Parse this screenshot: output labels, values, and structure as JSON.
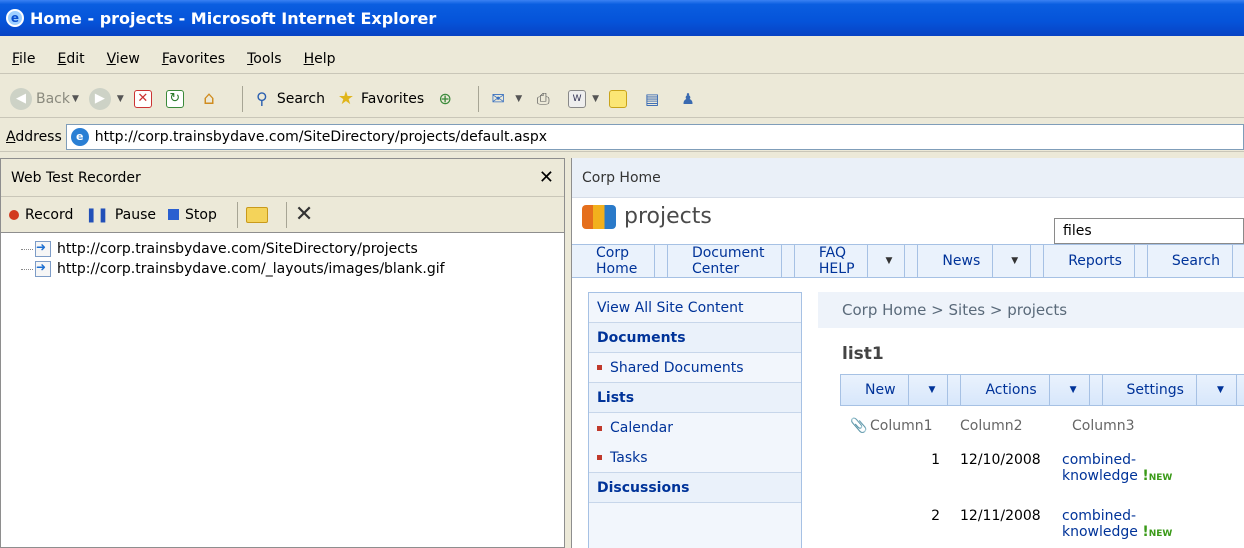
{
  "window": {
    "title": "Home - projects - Microsoft Internet Explorer"
  },
  "menu": [
    "File",
    "Edit",
    "View",
    "Favorites",
    "Tools",
    "Help"
  ],
  "toolbar": {
    "back_label": "Back",
    "search_label": "Search",
    "favorites_label": "Favorites"
  },
  "address": {
    "label": "Address",
    "url": "http://corp.trainsbydave.com/SiteDirectory/projects/default.aspx"
  },
  "recorder": {
    "title": "Web Test Recorder",
    "close": "✕",
    "record_label": "Record",
    "pause_label": "Pause",
    "stop_label": "Stop",
    "items": [
      "http://corp.trainsbydave.com/SiteDirectory/projects",
      "http://corp.trainsbydave.com/_layouts/images/blank.gif"
    ]
  },
  "sharepoint": {
    "top_link": "Corp Home",
    "site_title": "projects",
    "search_value": "files",
    "nav": [
      "Corp Home",
      "Document Center",
      "FAQ HELP",
      "News",
      "Reports",
      "Search"
    ],
    "quicklaunch": {
      "view_all": "View All Site Content",
      "documents_head": "Documents",
      "shared_documents": "Shared Documents",
      "lists_head": "Lists",
      "calendar": "Calendar",
      "tasks": "Tasks",
      "discussions_head": "Discussions"
    },
    "breadcrumb": "Corp Home > Sites > projects",
    "list_title": "list1",
    "list_toolbar": [
      "New",
      "Actions",
      "Settings"
    ],
    "columns": [
      "Column1",
      "Column2",
      "Column3"
    ],
    "rows": [
      {
        "c1": "1",
        "c2": "12/10/2008",
        "c3a": "combined-",
        "c3b": "knowledge",
        "new": "NEW"
      },
      {
        "c1": "2",
        "c2": "12/11/2008",
        "c3a": "combined-",
        "c3b": "knowledge",
        "new": "NEW"
      }
    ]
  }
}
